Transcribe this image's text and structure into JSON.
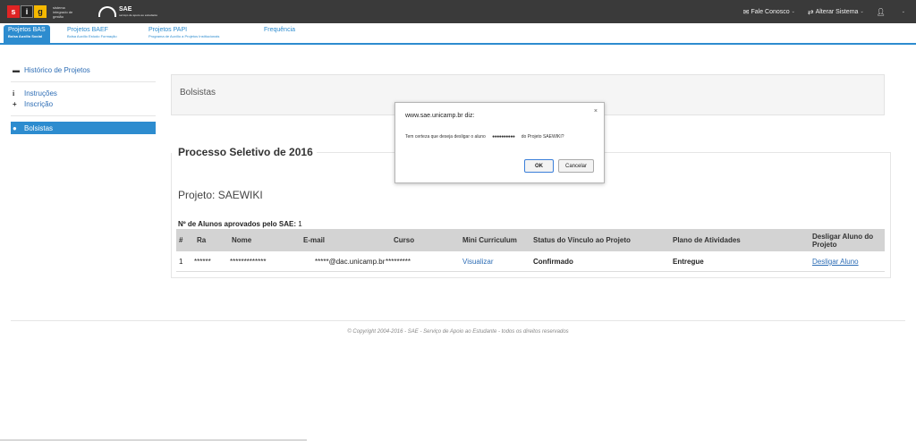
{
  "topbar": {
    "logo_letters": [
      "s",
      "i",
      "g"
    ],
    "logo_caption": "sistema integrado de gestão",
    "sae_logo": "SAE",
    "sae_logo_sub": "serviço de apoio ao estudante",
    "fale_conosco": "Fale Conosco",
    "alterar_sistema": "Alterar Sistema",
    "caret": "⌄"
  },
  "subnav": {
    "items": [
      {
        "title": "Projetos BAS",
        "subtitle": "Bolsa Auxílio Social"
      },
      {
        "title": "Projetos BAEF",
        "subtitle": "Bolsa Auxílio Estudo Formação"
      },
      {
        "title": "Projetos PAPI",
        "subtitle": "Programa de Auxílio a Projetos Institucionais"
      },
      {
        "title": "Frequência",
        "subtitle": ""
      }
    ]
  },
  "sidebar": {
    "items": [
      {
        "label": "Histórico de Projetos",
        "icon": "archive-icon"
      },
      {
        "label": "Instruções",
        "icon": "info-icon"
      },
      {
        "label": "Inscrição",
        "icon": "plus-icon"
      },
      {
        "label": "Bolsistas",
        "icon": "user-icon"
      }
    ]
  },
  "main": {
    "well_title": "Bolsistas",
    "panel_title": "Processo Seletivo de 2016",
    "projeto": "Projeto: SAEWIKI",
    "aprovados_label": "Nº de Alunos aprovados pelo SAE:",
    "aprovados_value": "1",
    "table": {
      "headers": [
        "#",
        "Ra",
        "Nome",
        "E-mail",
        "Curso",
        "Mini Curriculum",
        "Status do Vínculo ao Projeto",
        "Plano de Atividades",
        "Desligar Aluno do Projeto"
      ],
      "rows": [
        {
          "num": "1",
          "ra": "******",
          "nome": "*************",
          "email": "*****@dac.unicamp.br",
          "curso": "*********",
          "mini": "Visualizar",
          "status": "Confirmado",
          "plano": "Entregue",
          "desligar": "Desligar Aluno"
        }
      ]
    }
  },
  "footer": "© Copyright 2004-2016 - SAE - Serviço de Apoio ao Estudante - todos os direitos reservados",
  "dialog": {
    "host": "www.sae.unicamp.br diz:",
    "close": "×",
    "message_pre": "Tem certeza que deseja desligar o aluno",
    "message_name": "●●●●●●●●●●",
    "message_post": "do Projeto SAEWIKI?",
    "ok": "OK",
    "cancel": "Cancelar"
  }
}
